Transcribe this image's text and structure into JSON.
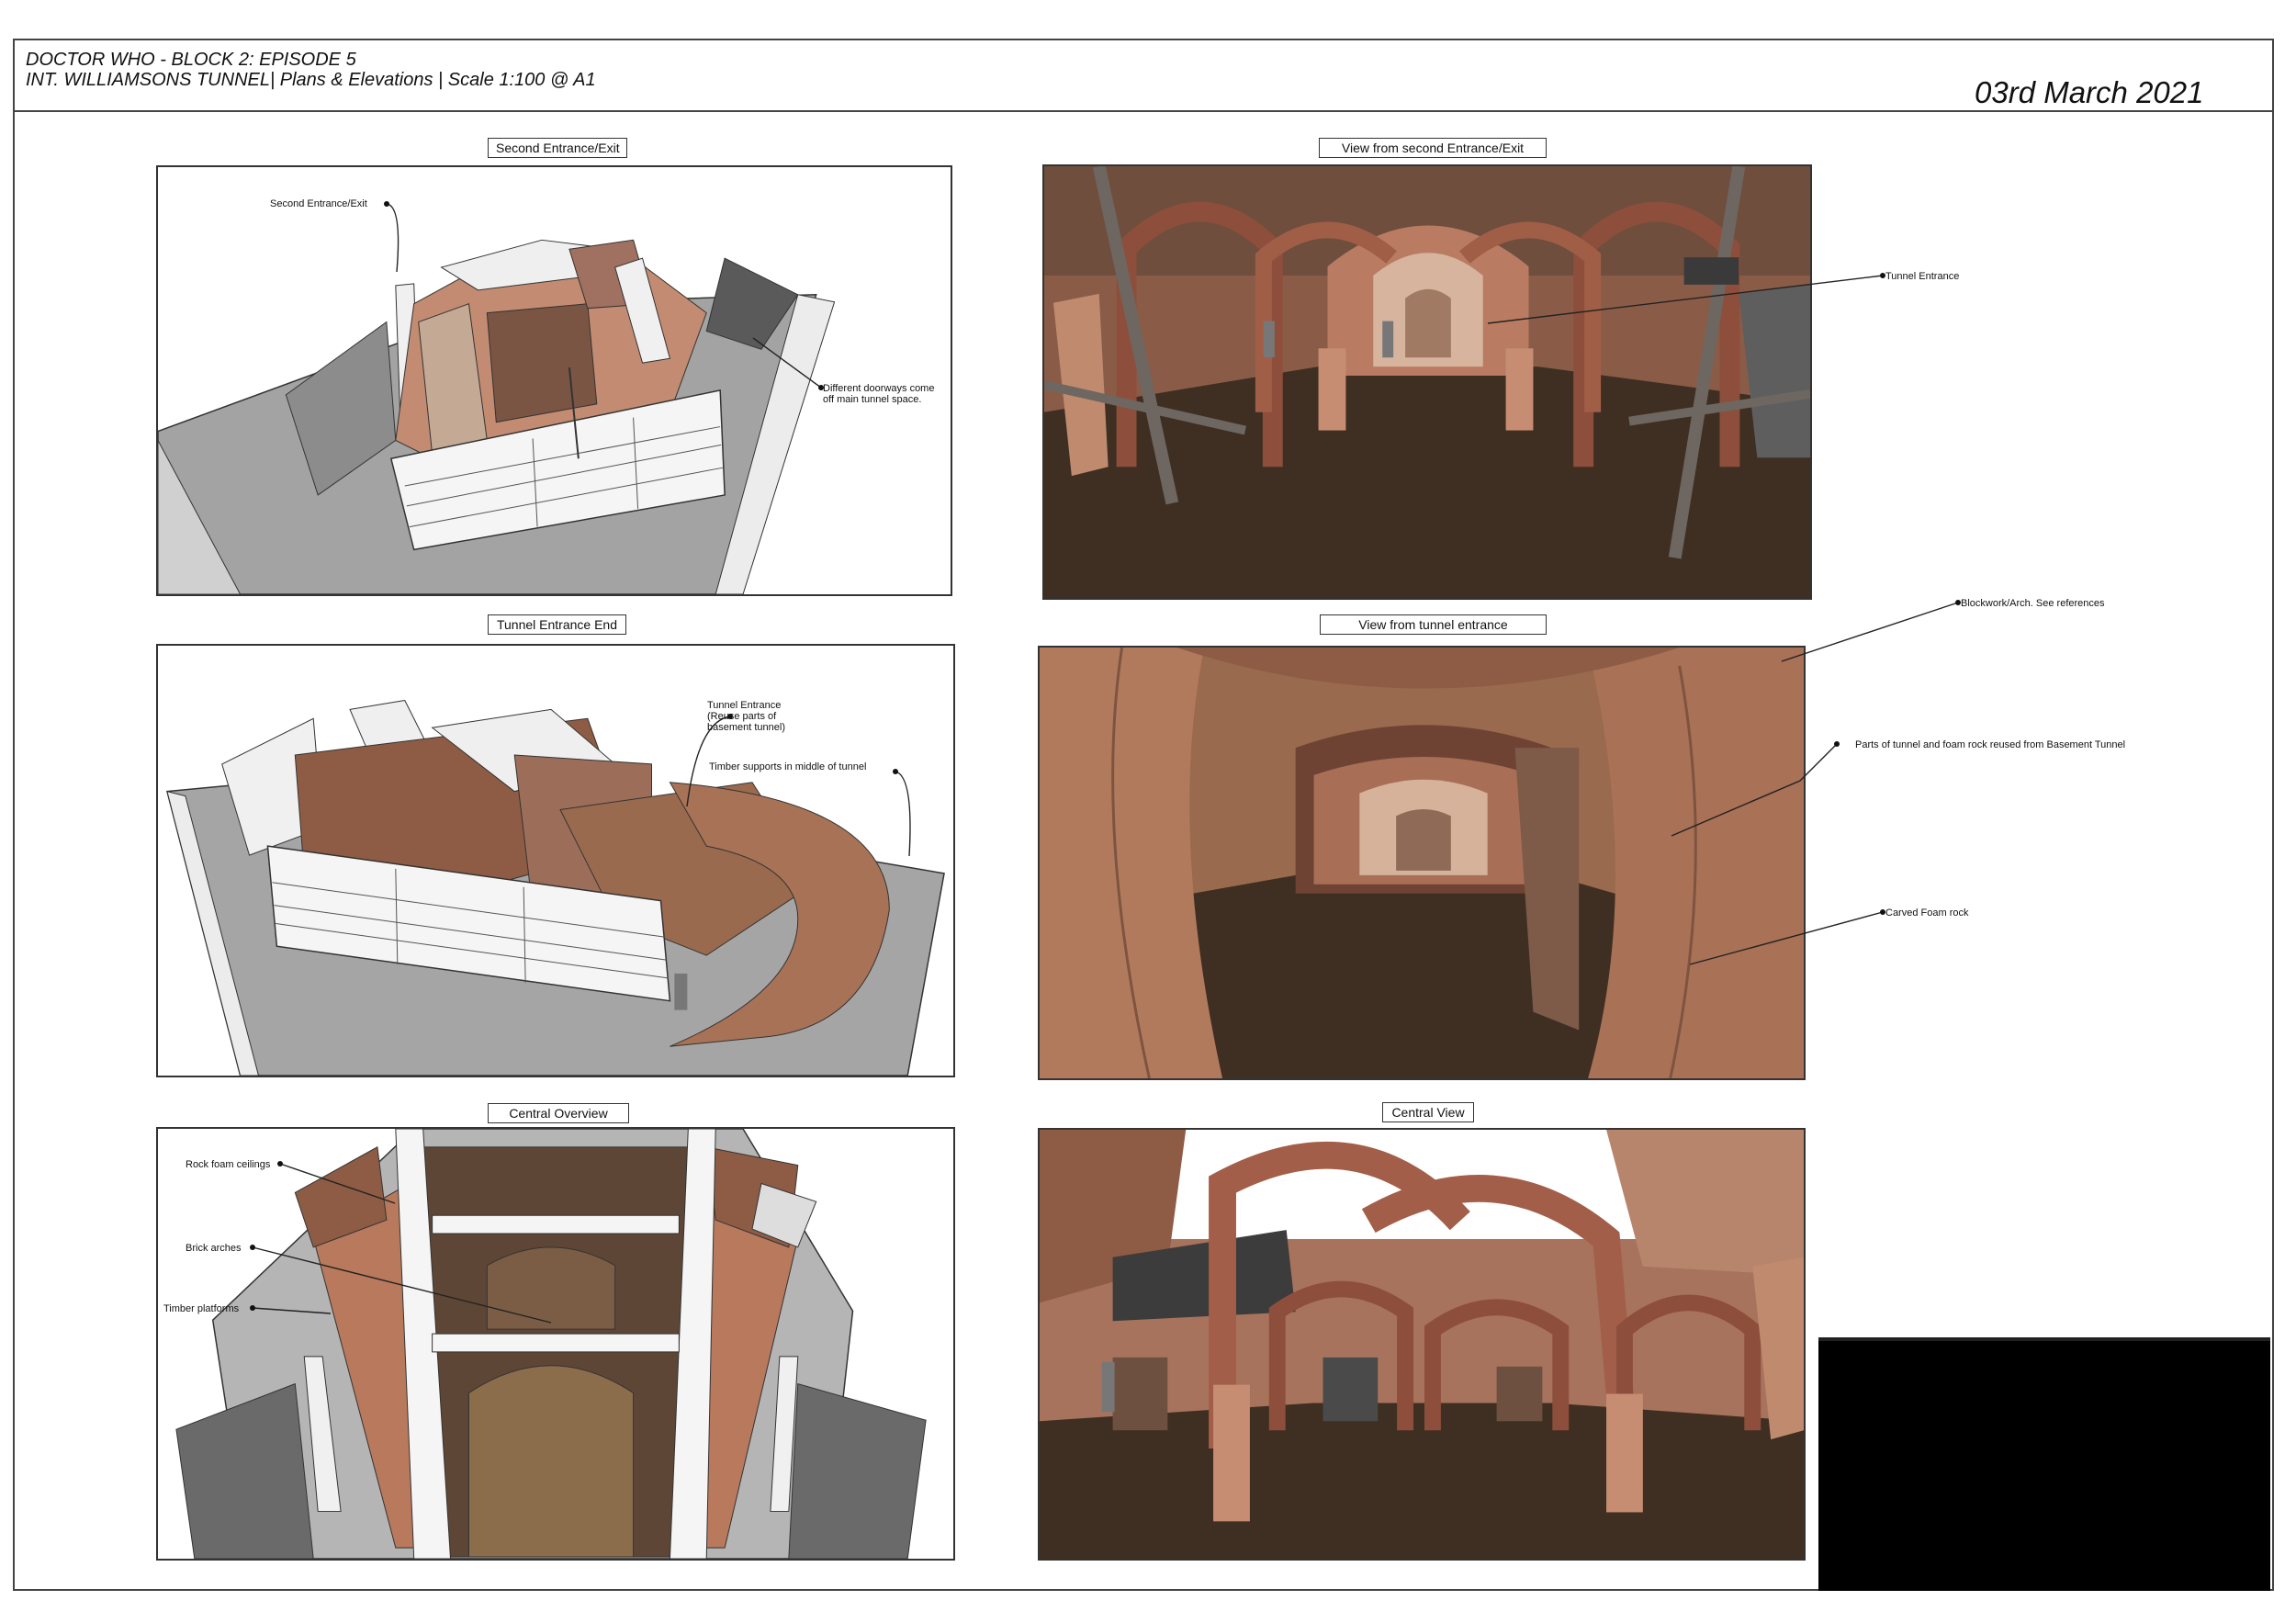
{
  "header": {
    "line1": "DOCTOR WHO - BLOCK 2: EPISODE 5",
    "line2": "INT. WILLIAMSONS TUNNEL| Plans & Elevations | Scale 1:100 @ A1",
    "date": "03rd March 2021"
  },
  "panels": {
    "p1": {
      "title": "Second Entrance/Exit"
    },
    "p2": {
      "title": "View from second Entrance/Exit"
    },
    "p3": {
      "title": "Tunnel Entrance End"
    },
    "p4": {
      "title": "View from tunnel entrance"
    },
    "p5": {
      "title": "Central Overview"
    },
    "p6": {
      "title": "Central View"
    }
  },
  "annotations": {
    "second_entrance": "Second Entrance/Exit",
    "different_doorways": "Different doorways come\noff main tunnel space.",
    "tunnel_entrance_view": "Tunnel Entrance",
    "tunnel_entrance_reuse": "Tunnel Entrance\n(Reuse parts of\nbasement tunnel)",
    "timber_supports": "Timber supports in middle of tunnel",
    "blockwork": "Blockwork/Arch. See references",
    "parts_reused": "Parts of tunnel and foam rock reused from Basement Tunnel",
    "carved_foam": "Carved Foam rock",
    "rock_foam_ceilings": "Rock foam ceilings",
    "brick_arches": "Brick arches",
    "timber_platforms": "Timber platforms"
  },
  "colors": {
    "brick": "#b87c62",
    "brick_dark": "#7e4a36",
    "floor": "#3e2f22",
    "foam_rock": "#9a6a4e",
    "timber": "#6e6660",
    "ground": "#9a9a9a",
    "wall_white": "#f2f2f2"
  }
}
